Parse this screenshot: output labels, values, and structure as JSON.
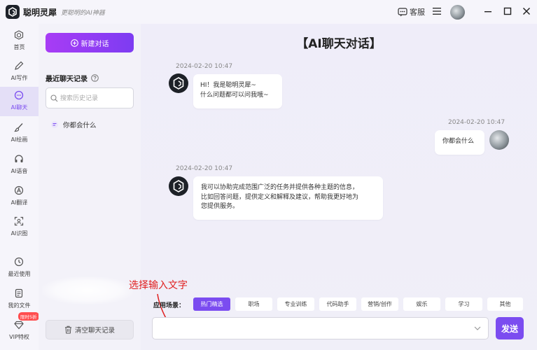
{
  "app": {
    "name": "聪明灵犀",
    "slogan": "更聪明的AI神器",
    "support_label": "客服"
  },
  "nav": {
    "items": [
      {
        "label": "首页",
        "icon": "cube-icon"
      },
      {
        "label": "AI写作",
        "icon": "pen-icon"
      },
      {
        "label": "AI聊天",
        "icon": "chat-icon",
        "active": true
      },
      {
        "label": "AI绘画",
        "icon": "brush-icon"
      },
      {
        "label": "AI语音",
        "icon": "headphones-icon"
      },
      {
        "label": "AI翻译",
        "icon": "translate-icon"
      },
      {
        "label": "AI识图",
        "icon": "scan-icon"
      },
      {
        "label": "最近使用",
        "icon": "clock-icon"
      },
      {
        "label": "我的文件",
        "icon": "file-icon"
      },
      {
        "label": "VIP特权",
        "icon": "diamond-icon"
      }
    ],
    "vip_badge": "限时5折"
  },
  "sidebar": {
    "new_chat_label": "新建对话",
    "recent_title": "最近聊天记录",
    "search_placeholder": "搜索历史记录",
    "history": [
      {
        "title": "你都会什么"
      }
    ],
    "clear_label": "清空聊天记录"
  },
  "main": {
    "title": "【AI聊天对话】",
    "messages": [
      {
        "role": "bot",
        "time": "2024-02-20 10:47",
        "lines": [
          "HI！我是聪明灵犀~",
          "什么问题都可以问我哦~"
        ]
      },
      {
        "role": "user",
        "time": "2024-02-20 10:47",
        "lines": [
          "你都会什么"
        ]
      },
      {
        "role": "bot",
        "time": "2024-02-20 10:47",
        "lines": [
          "我可以协助完成范围广泛的任务并提供各种主题的信息，",
          "比如回答问题，提供定义和解释及建议，帮助我更好地为",
          "您提供服务。"
        ]
      }
    ],
    "annotation": "选择输入文字",
    "scene_label": "应用场景：",
    "scenes": [
      {
        "label": "热门精选",
        "active": true
      },
      {
        "label": "职场"
      },
      {
        "label": "专业训练"
      },
      {
        "label": "代码助手"
      },
      {
        "label": "营销/创作"
      },
      {
        "label": "娱乐"
      },
      {
        "label": "学习"
      },
      {
        "label": "其他"
      }
    ],
    "input_value": "",
    "send_label": "发送"
  },
  "colors": {
    "accent": "#7b4cf0",
    "annotation": "#e02020"
  }
}
